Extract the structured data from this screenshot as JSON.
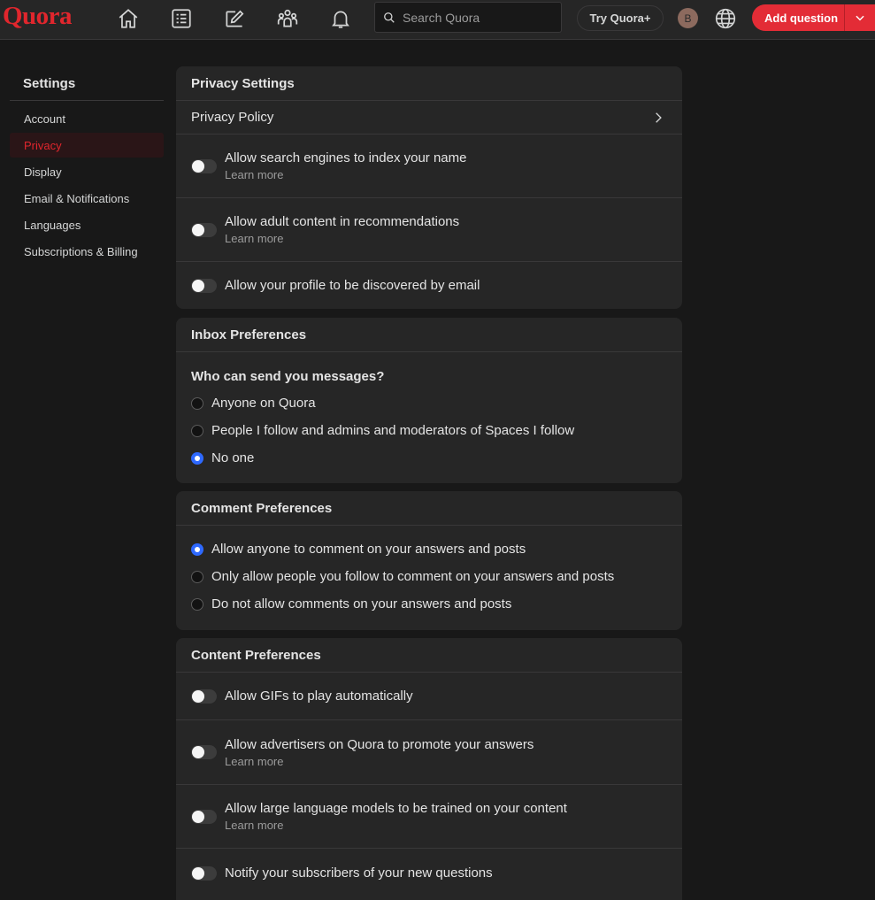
{
  "brand": {
    "logo": "Quora",
    "accent": "#e0262d"
  },
  "nav": {
    "icons": [
      "home-icon",
      "following-icon",
      "answer-icon",
      "spaces-icon",
      "notifications-icon"
    ],
    "search_placeholder": "Search Quora",
    "try_plus": "Try Quora+",
    "avatar_initial": "B",
    "add_question": "Add question"
  },
  "sidebar": {
    "title": "Settings",
    "items": [
      {
        "label": "Account"
      },
      {
        "label": "Privacy",
        "active": true
      },
      {
        "label": "Display"
      },
      {
        "label": "Email & Notifications"
      },
      {
        "label": "Languages"
      },
      {
        "label": "Subscriptions & Billing"
      }
    ]
  },
  "privacy": {
    "title": "Privacy Settings",
    "policy": "Privacy Policy",
    "toggles": [
      {
        "label": "Allow search engines to index your name",
        "sub": "Learn more",
        "on": false
      },
      {
        "label": "Allow adult content in recommendations",
        "sub": "Learn more",
        "on": false
      },
      {
        "label": "Allow your profile to be discovered by email",
        "on": false
      }
    ]
  },
  "inbox": {
    "title": "Inbox Preferences",
    "question": "Who can send you messages?",
    "options": [
      {
        "label": "Anyone on Quora",
        "selected": false
      },
      {
        "label": "People I follow and admins and moderators of Spaces I follow",
        "selected": false
      },
      {
        "label": "No one",
        "selected": true
      }
    ]
  },
  "comments": {
    "title": "Comment Preferences",
    "options": [
      {
        "label": "Allow anyone to comment on your answers and posts",
        "selected": true
      },
      {
        "label": "Only allow people you follow to comment on your answers and posts",
        "selected": false
      },
      {
        "label": "Do not allow comments on your answers and posts",
        "selected": false
      }
    ]
  },
  "content": {
    "title": "Content Preferences",
    "toggles": [
      {
        "label": "Allow GIFs to play automatically",
        "on": false
      },
      {
        "label": "Allow advertisers on Quora to promote your answers",
        "sub": "Learn more",
        "on": false
      },
      {
        "label": "Allow large language models to be trained on your content",
        "sub": "Learn more",
        "on": false
      },
      {
        "label": "Notify your subscribers of your new questions",
        "on": false
      }
    ]
  }
}
